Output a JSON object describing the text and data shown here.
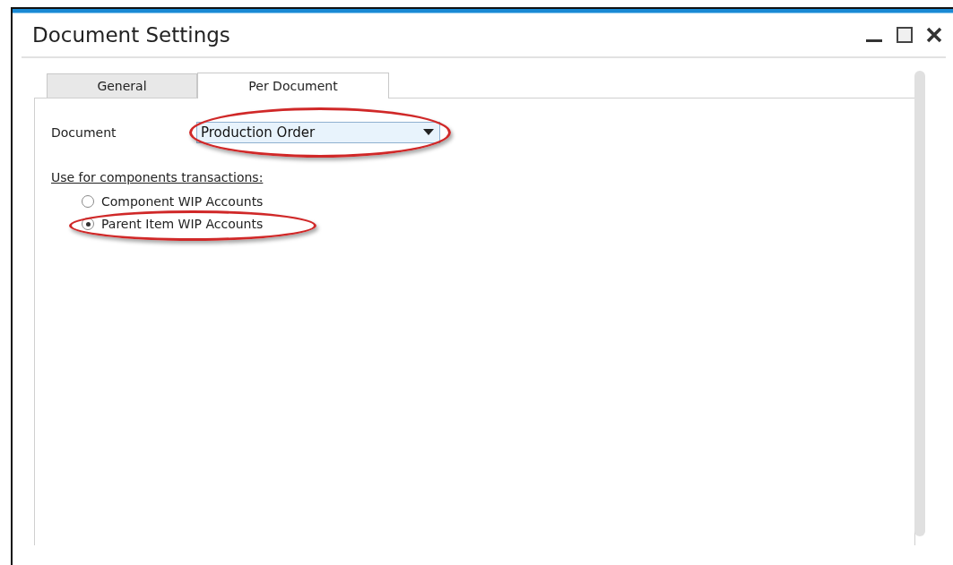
{
  "window": {
    "title": "Document Settings"
  },
  "tabs": [
    {
      "label": "General",
      "selected": false
    },
    {
      "label": "Per Document",
      "selected": true
    }
  ],
  "document_field": {
    "label": "Document",
    "value": "Production Order",
    "highlighted": true
  },
  "components_group": {
    "label": "Use for components transactions:",
    "options": [
      {
        "label": "Component WIP Accounts",
        "selected": false,
        "highlighted": false
      },
      {
        "label": "Parent Item WIP Accounts",
        "selected": true,
        "highlighted": true
      }
    ]
  }
}
